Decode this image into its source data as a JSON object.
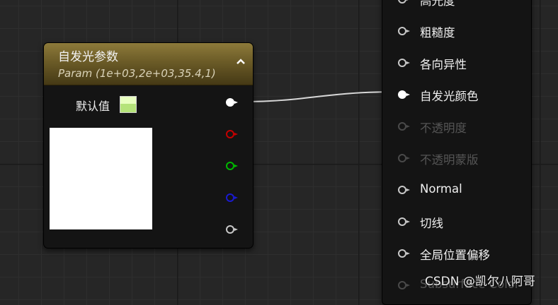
{
  "param_node": {
    "title": "自发光参数",
    "subtitle": "Param (1e+03,2e+03,35.4,1)",
    "collapse_glyph": "⌃",
    "default_label": "默认值",
    "swatch_color": "#c8f58f",
    "output_pins": [
      {
        "channel": "rgb",
        "color": "#ffffff",
        "connected": true
      },
      {
        "channel": "r",
        "color": "#c40000",
        "connected": false
      },
      {
        "channel": "g",
        "color": "#00b800",
        "connected": false
      },
      {
        "channel": "b",
        "color": "#1a1ad0",
        "connected": false
      },
      {
        "channel": "a",
        "color": "#c8c8c8",
        "connected": false
      }
    ]
  },
  "material_node": {
    "top_partial_label": "高光度",
    "rows": [
      {
        "label": "粗糙度",
        "enabled": true,
        "connected": false
      },
      {
        "label": "各向异性",
        "enabled": true,
        "connected": false
      },
      {
        "label": "自发光颜色",
        "enabled": true,
        "connected": true
      },
      {
        "label": "不透明度",
        "enabled": false,
        "connected": false
      },
      {
        "label": "不透明蒙版",
        "enabled": false,
        "connected": false
      },
      {
        "label": "Normal",
        "enabled": true,
        "connected": false
      },
      {
        "label": "切线",
        "enabled": true,
        "connected": false
      },
      {
        "label": "全局位置偏移",
        "enabled": true,
        "connected": false
      },
      {
        "label": "Subsurface Color",
        "enabled": false,
        "connected": false
      }
    ]
  },
  "watermark": "CSDN @凯尔八阿哥"
}
